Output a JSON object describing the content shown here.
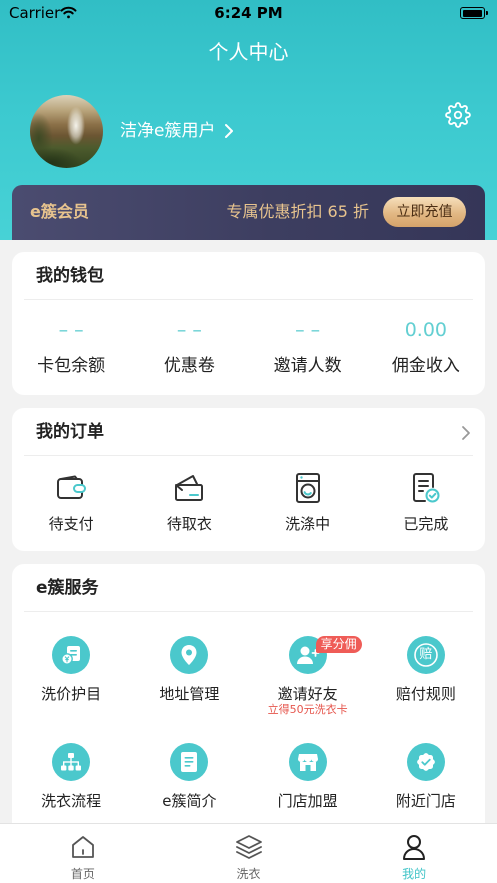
{
  "status_bar": {
    "carrier": "Carrier",
    "time": "6:24 PM",
    "battery_level": 1.0
  },
  "header": {
    "title": "个人中心"
  },
  "profile": {
    "username": "洁净e簇用户",
    "settings_icon": "gear-icon"
  },
  "member": {
    "title": "e簇会员",
    "discount_text": "专属优惠折扣 65 折",
    "recharge_label": "立即充值"
  },
  "wallet": {
    "title": "我的钱包",
    "items": [
      {
        "value": "– –",
        "label": "卡包余额"
      },
      {
        "value": "– –",
        "label": "优惠卷"
      },
      {
        "value": "– –",
        "label": "邀请人数"
      },
      {
        "value": "0.00",
        "label": "佣金收入"
      }
    ]
  },
  "orders": {
    "title": "我的订单",
    "items": [
      {
        "label": "待支付",
        "icon": "wallet-icon"
      },
      {
        "label": "待取衣",
        "icon": "box-icon"
      },
      {
        "label": "洗涤中",
        "icon": "washing-machine-icon"
      },
      {
        "label": "已完成",
        "icon": "document-check-icon"
      }
    ]
  },
  "services": {
    "title": "e簇服务",
    "items": [
      {
        "label": "洗价护目",
        "icon": "price-list-icon"
      },
      {
        "label": "地址管理",
        "icon": "location-pin-icon"
      },
      {
        "label": "邀请好友",
        "icon": "invite-friends-icon",
        "badge": "享分佣",
        "note": "立得50元洗衣卡"
      },
      {
        "label": "赔付规则",
        "icon": "compensation-icon",
        "icon_text": "赔"
      },
      {
        "label": "洗衣流程",
        "icon": "flowchart-icon"
      },
      {
        "label": "e簇简介",
        "icon": "document-icon"
      },
      {
        "label": "门店加盟",
        "icon": "store-icon"
      },
      {
        "label": "附近门店",
        "icon": "verified-badge-icon"
      }
    ]
  },
  "tab_bar": {
    "items": [
      {
        "label": "首页",
        "icon": "home-icon",
        "active": false
      },
      {
        "label": "洗衣",
        "icon": "layers-icon",
        "active": false
      },
      {
        "label": "我的",
        "icon": "person-icon",
        "active": true
      }
    ]
  },
  "colors": {
    "header_gradient_top": "#31bec5",
    "header_gradient_bottom": "#47d2d6",
    "accent": "#4bc8cc",
    "member_gold": "#e8c48e",
    "member_bg": "#3d3e60",
    "badge_red": "#ef5c57",
    "note_red": "#e6574e",
    "page_bg": "#f2f2f2"
  }
}
